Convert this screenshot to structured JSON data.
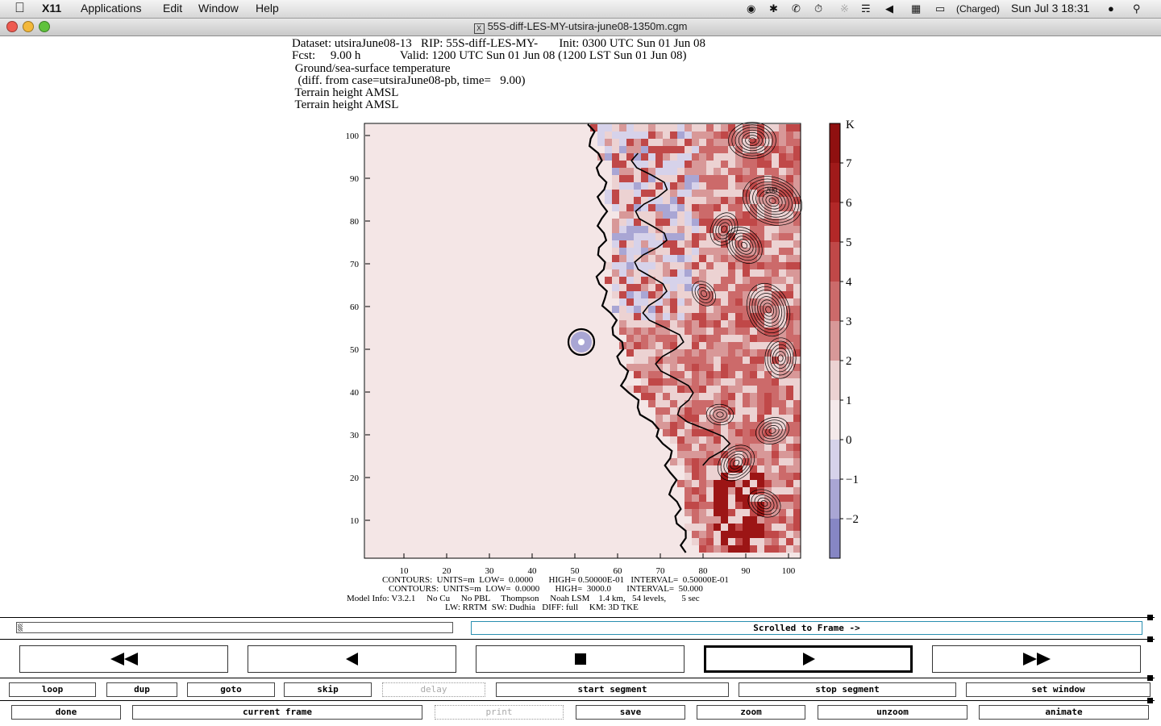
{
  "menubar": {
    "app": "X11",
    "items": [
      "Applications",
      "Edit",
      "Window",
      "Help"
    ],
    "battery": "(Charged)",
    "clock": "Sun Jul 3  18:31"
  },
  "window": {
    "title": "55S-diff-LES-MY-utsira-june08-1350m.cgm"
  },
  "plot": {
    "header": [
      "Dataset: utsiraJune08-13   RIP: 55S-diff-LES-MY-       Init: 0300 UTC Sun 01 Jun 08",
      "Fcst:     9.00 h             Valid: 1200 UTC Sun 01 Jun 08 (1200 LST Sun 01 Jun 08)",
      " Ground/sea-surface temperature",
      "  (diff. from case=utsiraJune08-pb, time=   9.00)",
      " Terrain height AMSL",
      " Terrain height AMSL"
    ],
    "footer": [
      "CONTOURS:  UNITS=m  LOW=  0.0000       HIGH= 0.50000E-01   INTERVAL=  0.50000E-01",
      "CONTOURS:  UNITS=m  LOW=  0.0000       HIGH=  3000.0       INTERVAL=  50.000",
      "Model Info: V3.2.1     No Cu     No PBL     Thompson     Noah LSM    1.4 km,   54 levels,       5 sec",
      "LW: RRTM  SW: Dudhia   DIFF: full     KM: 3D TKE"
    ],
    "contour_label": "200",
    "colorbar_unit": "K",
    "colorbar_labels": [
      "7",
      "6",
      "5",
      "4",
      "3",
      "2",
      "1",
      "0",
      "−1",
      "−2"
    ],
    "colorbar_colors": [
      "#8f1010",
      "#a01a1a",
      "#b22828",
      "#c04848",
      "#cc6a6a",
      "#d89898",
      "#ecd2d2",
      "#f4e9ea",
      "#d6d2ea",
      "#a9a6d4",
      "#8686c4"
    ],
    "land_colors": [
      "#cc6a6a",
      "#d89898",
      "#ecd2d2",
      "#d6d2ea",
      "#a9a6d4",
      "#c04848"
    ],
    "sea_color": "#f4e6e6",
    "x_ticks": [
      "10",
      "20",
      "30",
      "40",
      "50",
      "60",
      "70",
      "80",
      "90",
      "100"
    ],
    "y_ticks": [
      "100",
      "90",
      "80",
      "70",
      "60",
      "50",
      "40",
      "30",
      "20",
      "10"
    ]
  },
  "controls": {
    "status": "Scrolled to Frame ->",
    "row1": [
      "loop",
      "dup",
      "goto",
      "skip",
      "delay",
      "start segment",
      "stop segment",
      "set window"
    ],
    "row2": [
      "done",
      "current frame",
      "print",
      "save",
      "zoom",
      "unzoom",
      "animate"
    ]
  }
}
